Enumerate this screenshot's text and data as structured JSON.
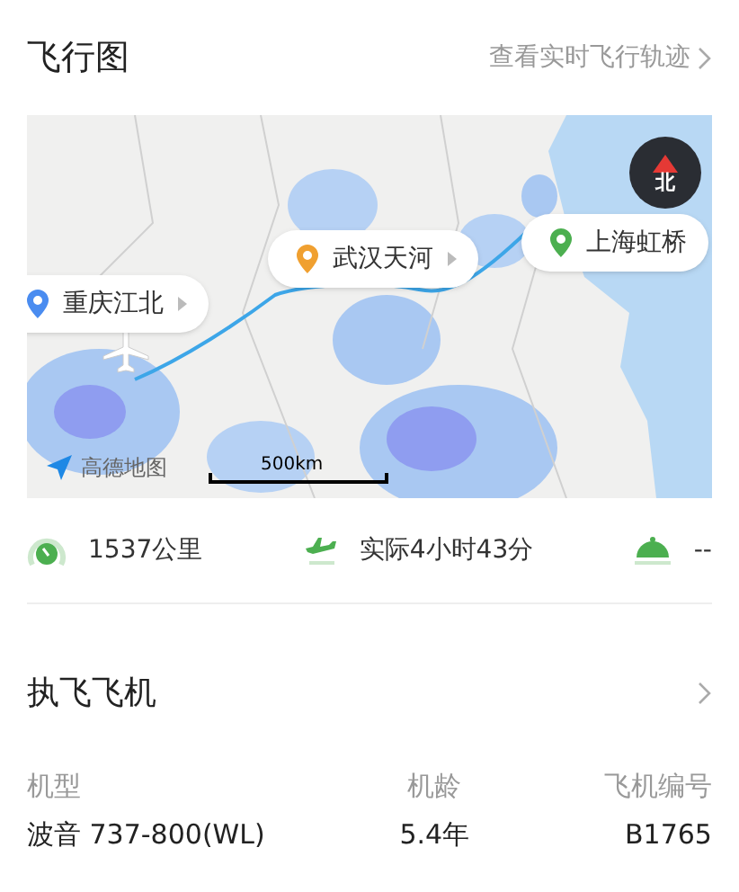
{
  "map_section": {
    "title": "飞行图",
    "link": "查看实时飞行轨迹",
    "map": {
      "kind": "picture",
      "compass": "北",
      "scale": "500km",
      "attribution": "高德地图",
      "pins": [
        {
          "label": "重庆江北",
          "color": "#4a8cf0"
        },
        {
          "label": "武汉天河",
          "color": "#f0a030"
        },
        {
          "label": "上海虹桥",
          "color": "#4caf50"
        }
      ]
    }
  },
  "stats": [
    {
      "kind": "distance",
      "text": "1537公里"
    },
    {
      "kind": "duration",
      "text": "实际4小时43分"
    },
    {
      "kind": "meal",
      "text": "--"
    }
  ],
  "aircraft": {
    "title": "执飞飞机",
    "fields": [
      {
        "label": "机型",
        "value": "波音 737-800(WL)"
      },
      {
        "label": "机龄",
        "value": "5.4年"
      },
      {
        "label": "飞机编号",
        "value": "B1765"
      }
    ]
  }
}
